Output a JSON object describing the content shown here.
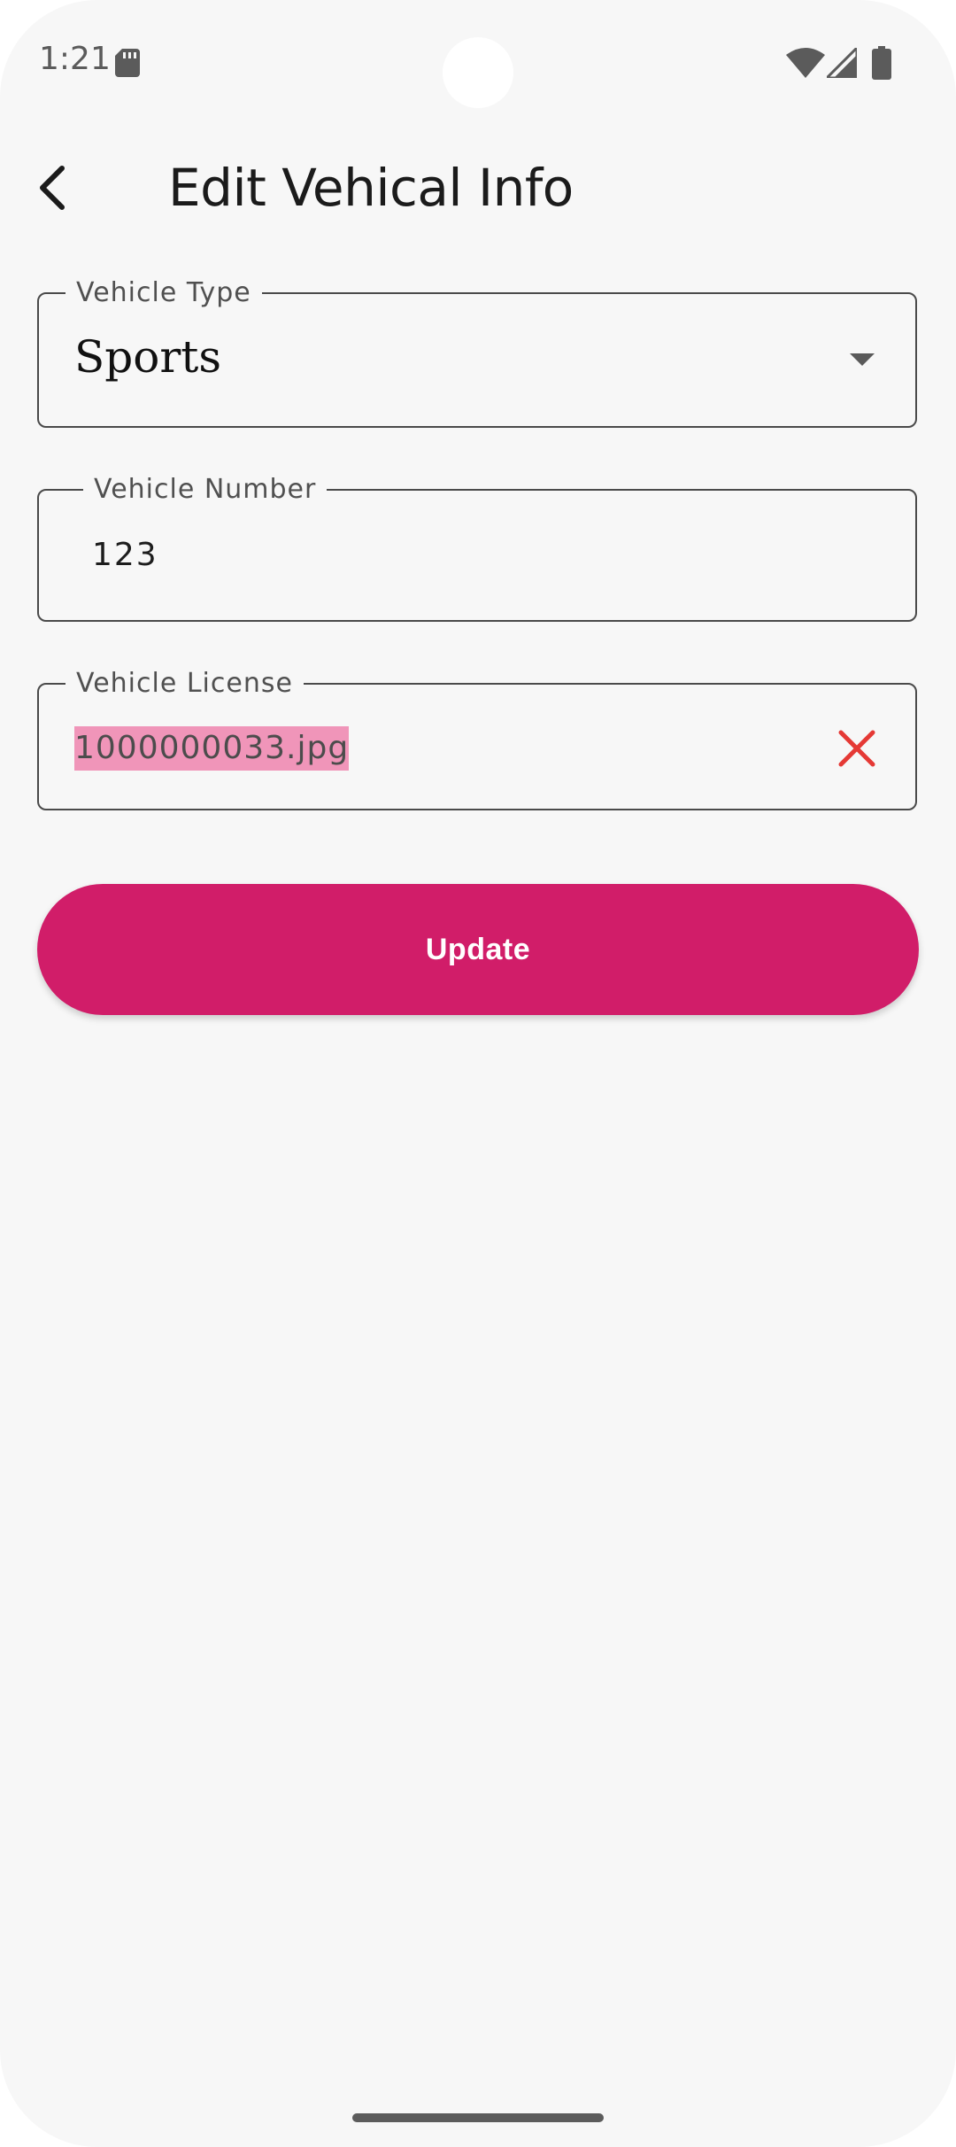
{
  "status_bar": {
    "time": "1:21",
    "icons": [
      "sd-card-icon",
      "wifi-icon",
      "signal-icon",
      "battery-icon"
    ]
  },
  "header": {
    "back_icon": "back-arrow-icon",
    "title": "Edit Vehical Info"
  },
  "form": {
    "vehicle_type": {
      "label": "Vehicle Type",
      "value": "Sports",
      "icon": "dropdown-arrow-icon"
    },
    "vehicle_number": {
      "label": "Vehicle Number",
      "value": "123"
    },
    "vehicle_license": {
      "label": "Vehicle License",
      "value": "1000000033.jpg",
      "clear_icon": "close-icon"
    }
  },
  "actions": {
    "update_label": "Update"
  },
  "colors": {
    "accent": "#d11d69",
    "clear_icon": "#e53935",
    "selection_highlight": "#f095b9",
    "background": "#f7f7f7"
  }
}
